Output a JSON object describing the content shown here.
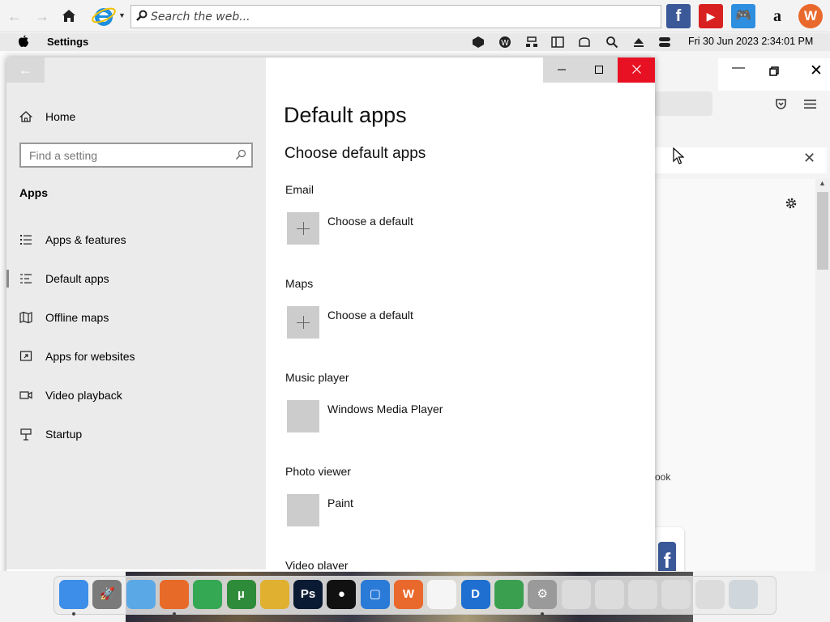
{
  "browser_toolbar": {
    "search_placeholder": "Search the web...",
    "bookmarks": [
      {
        "name": "facebook-bookmark",
        "glyph": "f",
        "color": "#3b5998"
      },
      {
        "name": "youtube-bookmark",
        "glyph": "▶",
        "color": "#d82020"
      },
      {
        "name": "games-bookmark",
        "glyph": "🎮",
        "color": "#2e8ee0"
      },
      {
        "name": "amazon-bookmark",
        "glyph": "a",
        "color": "#f3f3f3"
      },
      {
        "name": "w-bookmark",
        "glyph": "W",
        "color": "#e9692c"
      }
    ]
  },
  "menubar": {
    "app_name": "Settings",
    "clock": "Fri 30 Jun 2023  2:34:01 PM"
  },
  "settings": {
    "sidebar": {
      "home_label": "Home",
      "find_placeholder": "Find a setting",
      "section": "Apps",
      "items": [
        {
          "label": "Apps & features",
          "icon": "list-icon"
        },
        {
          "label": "Default apps",
          "icon": "default-list-icon"
        },
        {
          "label": "Offline maps",
          "icon": "map-icon"
        },
        {
          "label": "Apps for websites",
          "icon": "link-window-icon"
        },
        {
          "label": "Video playback",
          "icon": "video-icon"
        },
        {
          "label": "Startup",
          "icon": "startup-icon"
        }
      ]
    },
    "content": {
      "title": "Default apps",
      "subtitle": "Choose default apps",
      "categories": [
        {
          "label": "Email",
          "app": "Choose a default",
          "tile": "plus"
        },
        {
          "label": "Maps",
          "app": "Choose a default",
          "tile": "plus"
        },
        {
          "label": "Music player",
          "app": "Windows Media Player",
          "tile": "blank"
        },
        {
          "label": "Photo viewer",
          "app": "Paint",
          "tile": "blank"
        },
        {
          "label": "Video player",
          "app": "",
          "tile": "blank"
        }
      ]
    }
  },
  "background_window": {
    "tile_label": "ook"
  },
  "dock": {
    "items": [
      {
        "name": "finder",
        "color": "#3d8ee8",
        "glyph": ""
      },
      {
        "name": "launchpad",
        "color": "#7a7a7a",
        "glyph": "🚀"
      },
      {
        "name": "folder",
        "color": "#5aa8e6",
        "glyph": ""
      },
      {
        "name": "firefox",
        "color": "#e86a28",
        "glyph": ""
      },
      {
        "name": "chrome",
        "color": "#34a853",
        "glyph": ""
      },
      {
        "name": "utorrent",
        "color": "#2e8b3a",
        "glyph": "µ"
      },
      {
        "name": "files-app",
        "color": "#e0b030",
        "glyph": ""
      },
      {
        "name": "photoshop",
        "color": "#0b1a33",
        "glyph": "Ps"
      },
      {
        "name": "black-app",
        "color": "#111111",
        "glyph": "●"
      },
      {
        "name": "blue-square-app",
        "color": "#2a7ad8",
        "glyph": "▢"
      },
      {
        "name": "w-app",
        "color": "#e9692c",
        "glyph": "W"
      },
      {
        "name": "white-app",
        "color": "#f5f5f5",
        "glyph": ""
      },
      {
        "name": "d-app",
        "color": "#1e6fd0",
        "glyph": "D"
      },
      {
        "name": "globe-app",
        "color": "#3aa050",
        "glyph": ""
      },
      {
        "name": "system-settings",
        "color": "#9a9a9a",
        "glyph": "⚙"
      },
      {
        "name": "window-1",
        "color": "#dcdcdc",
        "glyph": ""
      },
      {
        "name": "window-2",
        "color": "#dcdcdc",
        "glyph": ""
      },
      {
        "name": "window-3",
        "color": "#dcdcdc",
        "glyph": ""
      },
      {
        "name": "window-4",
        "color": "#dcdcdc",
        "glyph": ""
      },
      {
        "name": "window-5",
        "color": "#dcdcdc",
        "glyph": ""
      },
      {
        "name": "trash",
        "color": "#cfd6dc",
        "glyph": ""
      }
    ]
  }
}
